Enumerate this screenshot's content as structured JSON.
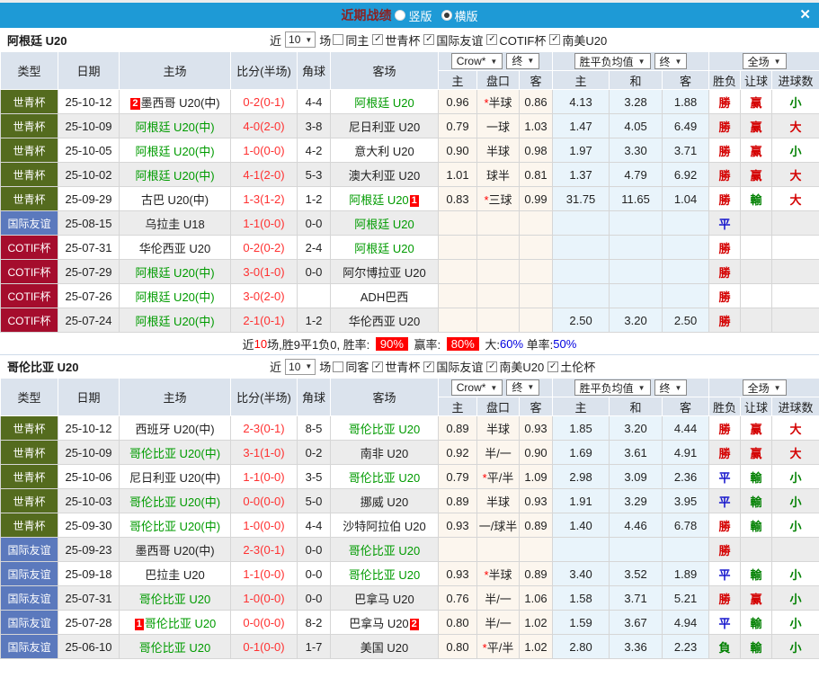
{
  "titlebar": {
    "title": "近期战绩",
    "vertical_label": "竖版",
    "horizontal_label": "横版",
    "close_glyph": "✕"
  },
  "icons": {
    "check": "✓",
    "arrow": "▼",
    "close": "✕"
  },
  "colors": {
    "accent_blue": "#1e9ad6",
    "title_red": "#8b2121",
    "team_green": "#009b00",
    "score_red": "#ff3131",
    "card_red": "#ff0000",
    "odds_bg": "#fcf6ee",
    "avg_bg": "#e9f4fb"
  },
  "type_colors": {
    "世青杯": "#546b1e",
    "国际友谊": "#5b79bd",
    "COTIF杯": "#a50d2d"
  },
  "result_colors": {
    "勝": "#d40000",
    "平": "#1414cc",
    "負": "#008000",
    "赢": "#d40000",
    "輸": "#008000",
    "大": "#d40000",
    "小": "#008000"
  },
  "columns": {
    "main": [
      "类型",
      "日期",
      "主场",
      "比分(半场)",
      "角球",
      "客场"
    ],
    "dropdowns": {
      "crow": "Crow*",
      "final": "终",
      "avg": "胜平负均值",
      "full": "全场"
    },
    "sub": [
      "主",
      "盘口",
      "客",
      "主",
      "和",
      "客",
      "胜负",
      "让球",
      "进球数"
    ]
  },
  "sections": [
    {
      "team": "阿根廷 U20",
      "filter": {
        "near_label": "近",
        "count": "10",
        "games_label": "场",
        "same_label": "同主",
        "same_checked": false,
        "leagues": [
          {
            "label": "世青杯",
            "checked": true
          },
          {
            "label": "国际友谊",
            "checked": true
          },
          {
            "label": "COTIF杯",
            "checked": true
          },
          {
            "label": "南美U20",
            "checked": true
          }
        ]
      },
      "rows": [
        {
          "type": "世青杯",
          "date": "25-10-12",
          "home": {
            "name": "墨西哥 U20(中)",
            "green": false,
            "card_pre": "2"
          },
          "score": "0-2(0-1)",
          "corner": "4-4",
          "away": {
            "name": "阿根廷 U20",
            "green": true
          },
          "odds": [
            "0.96",
            "*半球",
            "0.86"
          ],
          "avg": [
            "4.13",
            "3.28",
            "1.88"
          ],
          "res": [
            "勝",
            "赢",
            "小"
          ]
        },
        {
          "type": "世青杯",
          "date": "25-10-09",
          "home": {
            "name": "阿根廷 U20(中)",
            "green": true
          },
          "score": "4-0(2-0)",
          "corner": "3-8",
          "away": {
            "name": "尼日利亚 U20",
            "green": false
          },
          "odds": [
            "0.79",
            "一球",
            "1.03"
          ],
          "avg": [
            "1.47",
            "4.05",
            "6.49"
          ],
          "res": [
            "勝",
            "赢",
            "大"
          ]
        },
        {
          "type": "世青杯",
          "date": "25-10-05",
          "home": {
            "name": "阿根廷 U20(中)",
            "green": true
          },
          "score": "1-0(0-0)",
          "corner": "4-2",
          "away": {
            "name": "意大利 U20",
            "green": false
          },
          "odds": [
            "0.90",
            "半球",
            "0.98"
          ],
          "avg": [
            "1.97",
            "3.30",
            "3.71"
          ],
          "res": [
            "勝",
            "赢",
            "小"
          ]
        },
        {
          "type": "世青杯",
          "date": "25-10-02",
          "home": {
            "name": "阿根廷 U20(中)",
            "green": true
          },
          "score": "4-1(2-0)",
          "corner": "5-3",
          "away": {
            "name": "澳大利亚 U20",
            "green": false
          },
          "odds": [
            "1.01",
            "球半",
            "0.81"
          ],
          "avg": [
            "1.37",
            "4.79",
            "6.92"
          ],
          "res": [
            "勝",
            "赢",
            "大"
          ]
        },
        {
          "type": "世青杯",
          "date": "25-09-29",
          "home": {
            "name": "古巴 U20(中)",
            "green": false
          },
          "score": "1-3(1-2)",
          "corner": "1-2",
          "away": {
            "name": "阿根廷 U20",
            "green": true,
            "card_suf": "1"
          },
          "odds": [
            "0.83",
            "*三球",
            "0.99"
          ],
          "avg": [
            "31.75",
            "11.65",
            "1.04"
          ],
          "res": [
            "勝",
            "輸",
            "大"
          ]
        },
        {
          "type": "国际友谊",
          "date": "25-08-15",
          "home": {
            "name": "乌拉圭 U18",
            "green": false
          },
          "score": "1-1(0-0)",
          "corner": "0-0",
          "away": {
            "name": "阿根廷 U20",
            "green": true
          },
          "odds": [
            "",
            "",
            ""
          ],
          "avg": [
            "",
            "",
            ""
          ],
          "res": [
            "平",
            "",
            ""
          ]
        },
        {
          "type": "COTIF杯",
          "date": "25-07-31",
          "home": {
            "name": "华伦西亚 U20",
            "green": false
          },
          "score": "0-2(0-2)",
          "corner": "2-4",
          "away": {
            "name": "阿根廷 U20",
            "green": true
          },
          "odds": [
            "",
            "",
            ""
          ],
          "avg": [
            "",
            "",
            ""
          ],
          "res": [
            "勝",
            "",
            ""
          ]
        },
        {
          "type": "COTIF杯",
          "date": "25-07-29",
          "home": {
            "name": "阿根廷 U20(中)",
            "green": true
          },
          "score": "3-0(1-0)",
          "corner": "0-0",
          "away": {
            "name": "阿尔博拉亚 U20",
            "green": false
          },
          "odds": [
            "",
            "",
            ""
          ],
          "avg": [
            "",
            "",
            ""
          ],
          "res": [
            "勝",
            "",
            ""
          ]
        },
        {
          "type": "COTIF杯",
          "date": "25-07-26",
          "home": {
            "name": "阿根廷 U20(中)",
            "green": true
          },
          "score": "3-0(2-0)",
          "corner": "",
          "away": {
            "name": "ADH巴西",
            "green": false
          },
          "odds": [
            "",
            "",
            ""
          ],
          "avg": [
            "",
            "",
            ""
          ],
          "res": [
            "勝",
            "",
            ""
          ]
        },
        {
          "type": "COTIF杯",
          "date": "25-07-24",
          "home": {
            "name": "阿根廷 U20(中)",
            "green": true
          },
          "score": "2-1(0-1)",
          "corner": "1-2",
          "away": {
            "name": "华伦西亚 U20",
            "green": false
          },
          "odds": [
            "",
            "",
            ""
          ],
          "avg": [
            "2.50",
            "3.20",
            "2.50"
          ],
          "res": [
            "勝",
            "",
            ""
          ]
        }
      ],
      "summary": {
        "parts": [
          {
            "t": "近"
          },
          {
            "t": "10",
            "s": "r"
          },
          {
            "t": "场,胜9平1负0, 胜率: "
          },
          {
            "t": "90%",
            "s": "rb"
          },
          {
            "t": " 赢率: "
          },
          {
            "t": "80%",
            "s": "rb"
          },
          {
            "t": " 大:"
          },
          {
            "t": "60%",
            "s": "b"
          },
          {
            "t": " 单率:"
          },
          {
            "t": "50%",
            "s": "b"
          }
        ]
      }
    },
    {
      "team": "哥伦比亚 U20",
      "filter": {
        "near_label": "近",
        "count": "10",
        "games_label": "场",
        "same_label": "同客",
        "same_checked": false,
        "leagues": [
          {
            "label": "世青杯",
            "checked": true
          },
          {
            "label": "国际友谊",
            "checked": true
          },
          {
            "label": "南美U20",
            "checked": true
          },
          {
            "label": "土伦杯",
            "checked": true
          }
        ]
      },
      "rows": [
        {
          "type": "世青杯",
          "date": "25-10-12",
          "home": {
            "name": "西班牙 U20(中)",
            "green": false
          },
          "score": "2-3(0-1)",
          "corner": "8-5",
          "away": {
            "name": "哥伦比亚 U20",
            "green": true
          },
          "odds": [
            "0.89",
            "半球",
            "0.93"
          ],
          "avg": [
            "1.85",
            "3.20",
            "4.44"
          ],
          "res": [
            "勝",
            "赢",
            "大"
          ]
        },
        {
          "type": "世青杯",
          "date": "25-10-09",
          "home": {
            "name": "哥伦比亚 U20(中)",
            "green": true
          },
          "score": "3-1(1-0)",
          "corner": "0-2",
          "away": {
            "name": "南非 U20",
            "green": false
          },
          "odds": [
            "0.92",
            "半/一",
            "0.90"
          ],
          "avg": [
            "1.69",
            "3.61",
            "4.91"
          ],
          "res": [
            "勝",
            "赢",
            "大"
          ]
        },
        {
          "type": "世青杯",
          "date": "25-10-06",
          "home": {
            "name": "尼日利亚 U20(中)",
            "green": false
          },
          "score": "1-1(0-0)",
          "corner": "3-5",
          "away": {
            "name": "哥伦比亚 U20",
            "green": true
          },
          "odds": [
            "0.79",
            "*平/半",
            "1.09"
          ],
          "avg": [
            "2.98",
            "3.09",
            "2.36"
          ],
          "res": [
            "平",
            "輸",
            "小"
          ]
        },
        {
          "type": "世青杯",
          "date": "25-10-03",
          "home": {
            "name": "哥伦比亚 U20(中)",
            "green": true
          },
          "score": "0-0(0-0)",
          "corner": "5-0",
          "away": {
            "name": "挪威 U20",
            "green": false
          },
          "odds": [
            "0.89",
            "半球",
            "0.93"
          ],
          "avg": [
            "1.91",
            "3.29",
            "3.95"
          ],
          "res": [
            "平",
            "輸",
            "小"
          ]
        },
        {
          "type": "世青杯",
          "date": "25-09-30",
          "home": {
            "name": "哥伦比亚 U20(中)",
            "green": true
          },
          "score": "1-0(0-0)",
          "corner": "4-4",
          "away": {
            "name": "沙特阿拉伯 U20",
            "green": false
          },
          "odds": [
            "0.93",
            "一/球半",
            "0.89"
          ],
          "avg": [
            "1.40",
            "4.46",
            "6.78"
          ],
          "res": [
            "勝",
            "輸",
            "小"
          ]
        },
        {
          "type": "国际友谊",
          "date": "25-09-23",
          "home": {
            "name": "墨西哥 U20(中)",
            "green": false
          },
          "score": "2-3(0-1)",
          "corner": "0-0",
          "away": {
            "name": "哥伦比亚 U20",
            "green": true
          },
          "odds": [
            "",
            "",
            ""
          ],
          "avg": [
            "",
            "",
            ""
          ],
          "res": [
            "勝",
            "",
            ""
          ]
        },
        {
          "type": "国际友谊",
          "date": "25-09-18",
          "home": {
            "name": "巴拉圭 U20",
            "green": false
          },
          "score": "1-1(0-0)",
          "corner": "0-0",
          "away": {
            "name": "哥伦比亚 U20",
            "green": true
          },
          "odds": [
            "0.93",
            "*半球",
            "0.89"
          ],
          "avg": [
            "3.40",
            "3.52",
            "1.89"
          ],
          "res": [
            "平",
            "輸",
            "小"
          ]
        },
        {
          "type": "国际友谊",
          "date": "25-07-31",
          "home": {
            "name": "哥伦比亚 U20",
            "green": true
          },
          "score": "1-0(0-0)",
          "corner": "0-0",
          "away": {
            "name": "巴拿马 U20",
            "green": false
          },
          "odds": [
            "0.76",
            "半/一",
            "1.06"
          ],
          "avg": [
            "1.58",
            "3.71",
            "5.21"
          ],
          "res": [
            "勝",
            "赢",
            "小"
          ]
        },
        {
          "type": "国际友谊",
          "date": "25-07-28",
          "home": {
            "name": "哥伦比亚 U20",
            "green": true,
            "card_pre": "1"
          },
          "score": "0-0(0-0)",
          "corner": "8-2",
          "away": {
            "name": "巴拿马 U20",
            "green": false,
            "card_suf": "2"
          },
          "odds": [
            "0.80",
            "半/一",
            "1.02"
          ],
          "avg": [
            "1.59",
            "3.67",
            "4.94"
          ],
          "res": [
            "平",
            "輸",
            "小"
          ]
        },
        {
          "type": "国际友谊",
          "date": "25-06-10",
          "home": {
            "name": "哥伦比亚 U20",
            "green": true
          },
          "score": "0-1(0-0)",
          "corner": "1-7",
          "away": {
            "name": "美国 U20",
            "green": false
          },
          "odds": [
            "0.80",
            "*平/半",
            "1.02"
          ],
          "avg": [
            "2.80",
            "3.36",
            "2.23"
          ],
          "res": [
            "負",
            "輸",
            "小"
          ]
        }
      ]
    }
  ]
}
